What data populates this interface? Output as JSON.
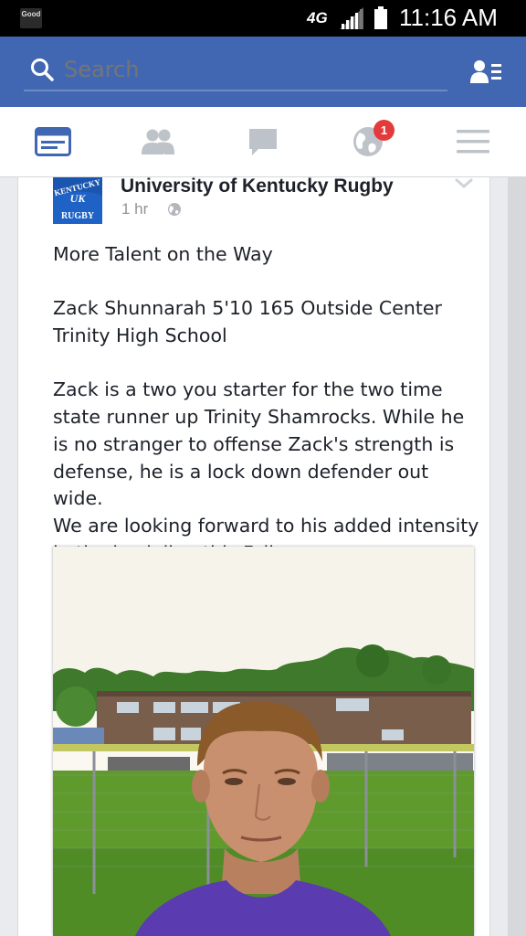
{
  "status_bar": {
    "app_label": "Good",
    "network": "4G",
    "time": "11:16 AM"
  },
  "search": {
    "placeholder": "Search"
  },
  "tabs": {
    "notifications_badge": "1"
  },
  "post": {
    "author": "University of Kentucky Rugby",
    "time": "1 hr",
    "avatar_text_top": "KENTUCKY",
    "avatar_text_mid": "UK",
    "avatar_text_bottom": "RUGBY",
    "paragraphs": [
      [
        "More Talent on the Way"
      ],
      [
        "Zack Shunnarah 5'10 165  Outside Center",
        "Trinity High School"
      ],
      [
        "Zack is a two you starter for the two time",
        "state runner up Trinity Shamrocks.  While he",
        "is no stranger to offense Zack's strength is",
        "defense, he is a lock down defender out wide.",
        "We are looking forward to his added intensity",
        "in the back line this Fall."
      ]
    ]
  },
  "colors": {
    "header_blue": "#4267b2",
    "badge_red": "#e33b3b",
    "active_tab": "#4267b2",
    "inactive_tab": "#bec3c9"
  }
}
